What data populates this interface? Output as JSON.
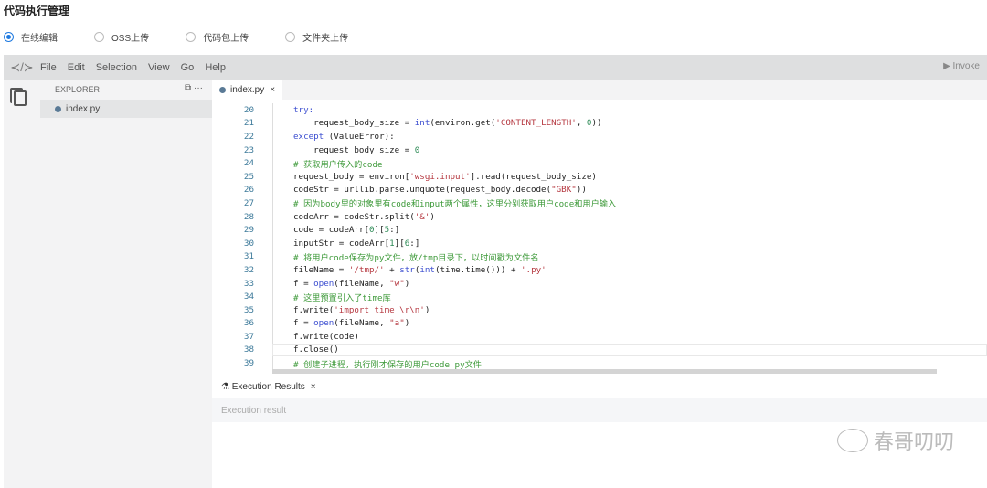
{
  "page": {
    "title": "代码执行管理"
  },
  "radios": [
    {
      "label": "在线编辑",
      "selected": true
    },
    {
      "label": "OSS上传",
      "selected": false
    },
    {
      "label": "代码包上传",
      "selected": false
    },
    {
      "label": "文件夹上传",
      "selected": false
    }
  ],
  "menu": [
    "File",
    "Edit",
    "Selection",
    "View",
    "Go",
    "Help"
  ],
  "invoke_label": "▶ Invoke",
  "explorer": {
    "title": "EXPLORER",
    "actions": "⧉  ···",
    "file": "index.py"
  },
  "tab": {
    "label": "index.py",
    "close": "×"
  },
  "current_line": 38,
  "code": [
    {
      "n": "20",
      "t": [
        [
          "kw",
          "try:"
        ]
      ]
    },
    {
      "n": "21",
      "t": [
        [
          "",
          "    request_body_size = "
        ],
        [
          "kw",
          "int"
        ],
        [
          "",
          "(environ.get("
        ],
        [
          "st",
          "'CONTENT_LENGTH'"
        ],
        [
          "",
          ", "
        ],
        [
          "nu",
          "0"
        ],
        [
          "",
          "))"
        ]
      ]
    },
    {
      "n": "22",
      "t": [
        [
          "kw",
          "except"
        ],
        [
          "",
          " (ValueError):"
        ]
      ]
    },
    {
      "n": "23",
      "t": [
        [
          "",
          "    request_body_size = "
        ],
        [
          "nu",
          "0"
        ]
      ]
    },
    {
      "n": "24",
      "t": [
        [
          "cm",
          "# 获取用户传入的code"
        ]
      ]
    },
    {
      "n": "25",
      "t": [
        [
          "",
          "request_body = environ["
        ],
        [
          "st",
          "'wsgi.input'"
        ],
        [
          "",
          "].read(request_body_size)"
        ]
      ]
    },
    {
      "n": "26",
      "t": [
        [
          "",
          "codeStr = urllib.parse.unquote(request_body.decode("
        ],
        [
          "st",
          "\"GBK\""
        ],
        [
          "",
          "))"
        ]
      ]
    },
    {
      "n": "27",
      "t": [
        [
          "cm",
          "# 因为body里的对象里有code和input两个属性，这里分别获取用户code和用户输入"
        ]
      ]
    },
    {
      "n": "28",
      "t": [
        [
          "",
          "codeArr = codeStr.split("
        ],
        [
          "st",
          "'&'"
        ],
        [
          ")",
          ")"
        ]
      ]
    },
    {
      "n": "29",
      "t": [
        [
          "",
          "code = codeArr["
        ],
        [
          "nu",
          "0"
        ],
        [
          "",
          "]["
        ],
        [
          "nu",
          "5"
        ],
        [
          "",
          ":]"
        ]
      ]
    },
    {
      "n": "30",
      "t": [
        [
          "",
          "inputStr = codeArr["
        ],
        [
          "nu",
          "1"
        ],
        [
          "",
          "]["
        ],
        [
          "nu",
          "6"
        ],
        [
          "",
          ":]"
        ]
      ]
    },
    {
      "n": "31",
      "t": [
        [
          "cm",
          "# 将用户code保存为py文件，放/tmp目录下，以时间戳为文件名"
        ]
      ]
    },
    {
      "n": "32",
      "t": [
        [
          "",
          "fileName = "
        ],
        [
          "st",
          "'/tmp/'"
        ],
        [
          "",
          " + "
        ],
        [
          "kw",
          "str"
        ],
        [
          "",
          "("
        ],
        [
          "kw",
          "int"
        ],
        [
          "",
          "(time.time())) + "
        ],
        [
          "st",
          "'.py'"
        ]
      ]
    },
    {
      "n": "33",
      "t": [
        [
          "",
          "f = "
        ],
        [
          "kw",
          "open"
        ],
        [
          "",
          "(fileName, "
        ],
        [
          "st",
          "\"w\""
        ],
        [
          "",
          ")"
        ]
      ]
    },
    {
      "n": "34",
      "t": [
        [
          "cm",
          "# 这里预置引入了time库"
        ]
      ]
    },
    {
      "n": "35",
      "t": [
        [
          "",
          "f.write("
        ],
        [
          "st",
          "'import time \\r\\n'"
        ],
        [
          "",
          ")"
        ]
      ]
    },
    {
      "n": "36",
      "t": [
        [
          "",
          "f = "
        ],
        [
          "kw",
          "open"
        ],
        [
          "",
          "(fileName, "
        ],
        [
          "st",
          "\"a\""
        ],
        [
          "",
          ")"
        ]
      ]
    },
    {
      "n": "37",
      "t": [
        [
          "",
          "f.write(code)"
        ]
      ]
    },
    {
      "n": "38",
      "t": [
        [
          "",
          "f.close()"
        ]
      ]
    },
    {
      "n": "39",
      "t": [
        [
          "cm",
          "# 创建子进程，执行刚才保存的用户code py文件"
        ]
      ]
    }
  ],
  "results": {
    "tab": "Execution Results",
    "close": "×",
    "placeholder": "Execution result"
  },
  "watermark": "春哥叨叨"
}
